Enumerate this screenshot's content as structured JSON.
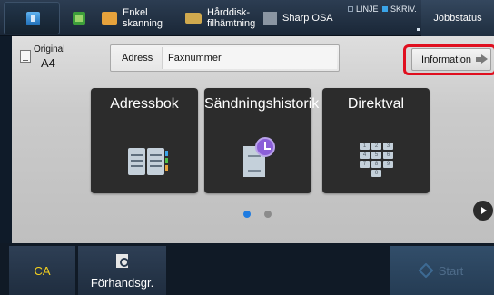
{
  "topbar": {
    "items": [
      {
        "label_1": "Enkel",
        "label_2": "skanning"
      },
      {
        "label_1": "Hårddisk-",
        "label_2": "filhämtning"
      },
      {
        "label": "Sharp OSA"
      }
    ],
    "status": {
      "line": "LINJE",
      "print": "SKRIV."
    },
    "job_status": "Jobbstatus"
  },
  "original": {
    "label": "Original",
    "size": "A4"
  },
  "address": {
    "label": "Adress",
    "value": "Faxnummer"
  },
  "information_button": "Information",
  "tiles": [
    {
      "label": "Adressbok"
    },
    {
      "label": "Sändningshistorik"
    },
    {
      "label": "Direktval"
    }
  ],
  "keypad": [
    "1",
    "2",
    "3",
    "4",
    "5",
    "6",
    "7",
    "8",
    "9",
    "",
    "0",
    ""
  ],
  "pagination": {
    "pages": 2,
    "current": 1
  },
  "bottom": {
    "ca": "CA",
    "preview": "Förhandsgr.",
    "start": "Start"
  },
  "colors": {
    "highlight": "#e00f1f",
    "ca_text": "#f5d11e",
    "active_dot": "#1e7be0"
  }
}
